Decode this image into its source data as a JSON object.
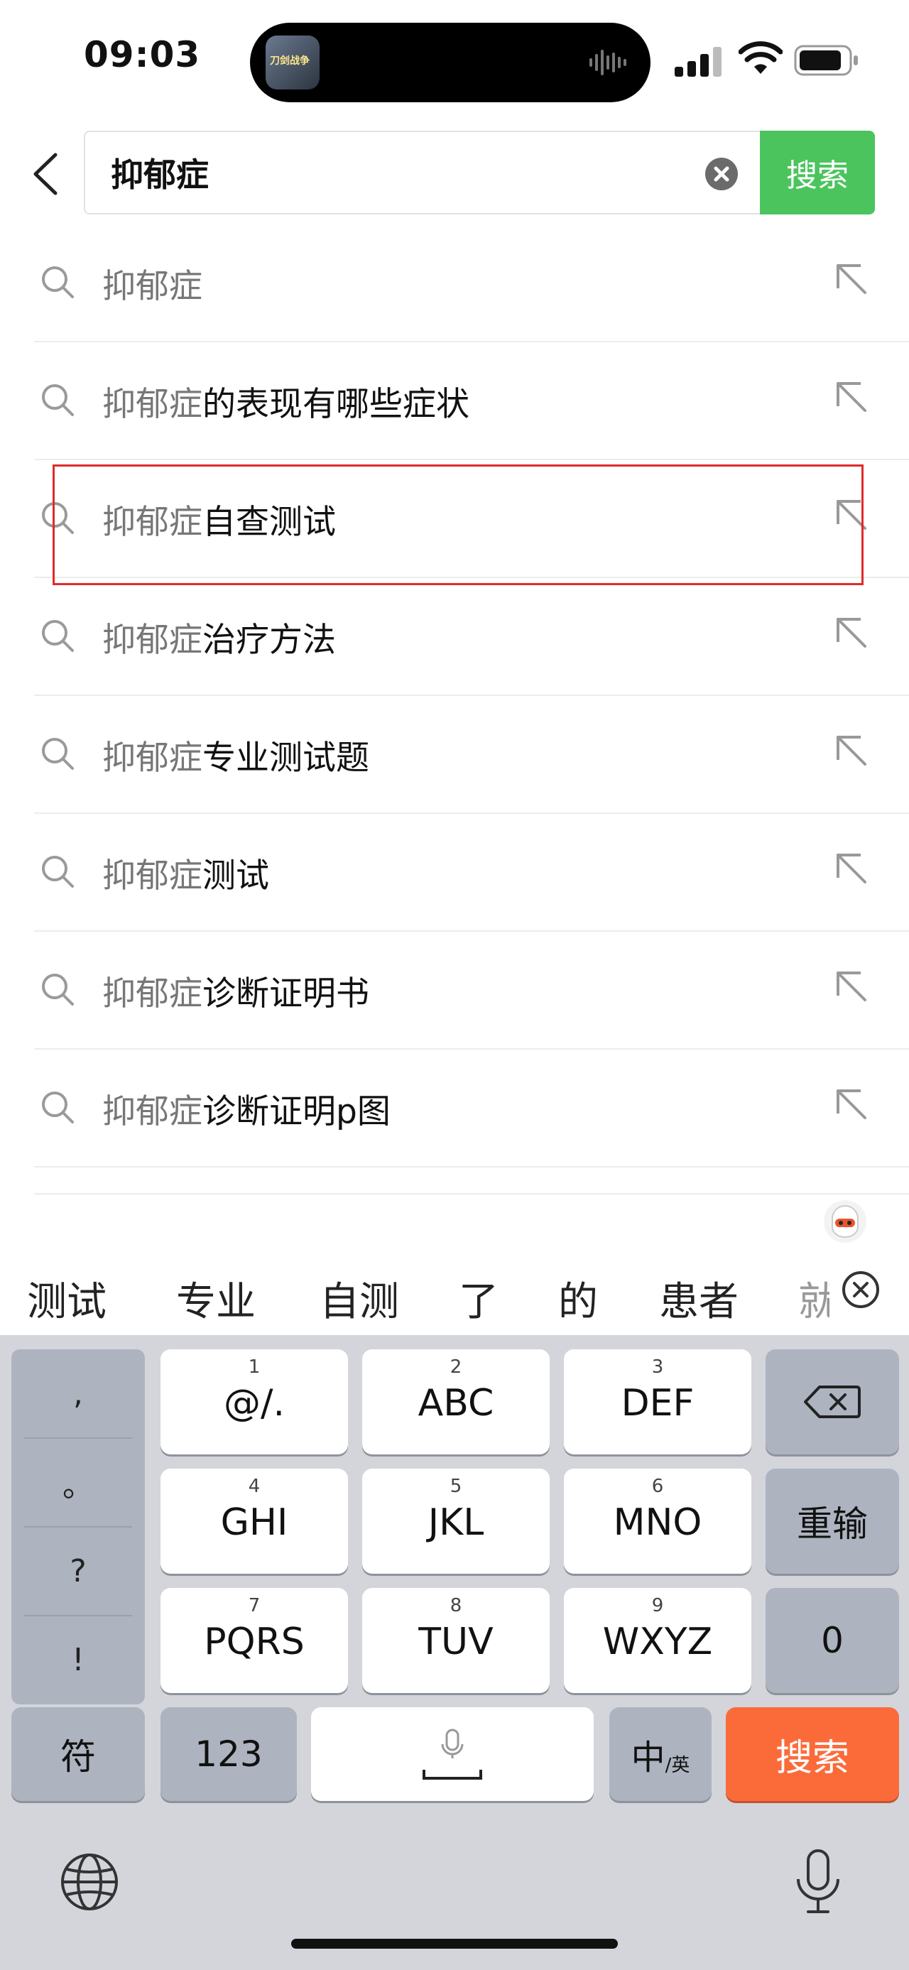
{
  "status_bar": {
    "time": "09:03",
    "island_app_text": "刀剑战争"
  },
  "search": {
    "query": "抑郁症",
    "button_label": "搜索"
  },
  "suggestions": [
    {
      "prefix": "抑郁症",
      "suffix": ""
    },
    {
      "prefix": "抑郁症",
      "suffix": "的表现有哪些症状"
    },
    {
      "prefix": "抑郁症",
      "suffix": "自查测试"
    },
    {
      "prefix": "抑郁症",
      "suffix": "治疗方法"
    },
    {
      "prefix": "抑郁症",
      "suffix": "专业测试题"
    },
    {
      "prefix": "抑郁症",
      "suffix": "测试"
    },
    {
      "prefix": "抑郁症",
      "suffix": "诊断证明书"
    },
    {
      "prefix": "抑郁症",
      "suffix": "诊断证明p图"
    }
  ],
  "candidates": [
    "测试",
    "专业",
    "自测",
    "了",
    "的",
    "患者",
    "就"
  ],
  "keyboard": {
    "punct": [
      ",",
      "。",
      "?",
      "!"
    ],
    "keys": [
      {
        "num": "1",
        "label": "@/."
      },
      {
        "num": "2",
        "label": "ABC"
      },
      {
        "num": "3",
        "label": "DEF"
      },
      {
        "num": "4",
        "label": "GHI"
      },
      {
        "num": "5",
        "label": "JKL"
      },
      {
        "num": "6",
        "label": "MNO"
      },
      {
        "num": "7",
        "label": "PQRS"
      },
      {
        "num": "8",
        "label": "TUV"
      },
      {
        "num": "9",
        "label": "WXYZ"
      }
    ],
    "retype": "重输",
    "zero": "0",
    "symbols": "符",
    "numbers": "123",
    "lang_main": "中",
    "lang_sub": "/英",
    "search": "搜索"
  },
  "colors": {
    "accent_green": "#4cc45e",
    "accent_orange": "#fb6b3a",
    "highlight_red": "#e02a2a"
  }
}
